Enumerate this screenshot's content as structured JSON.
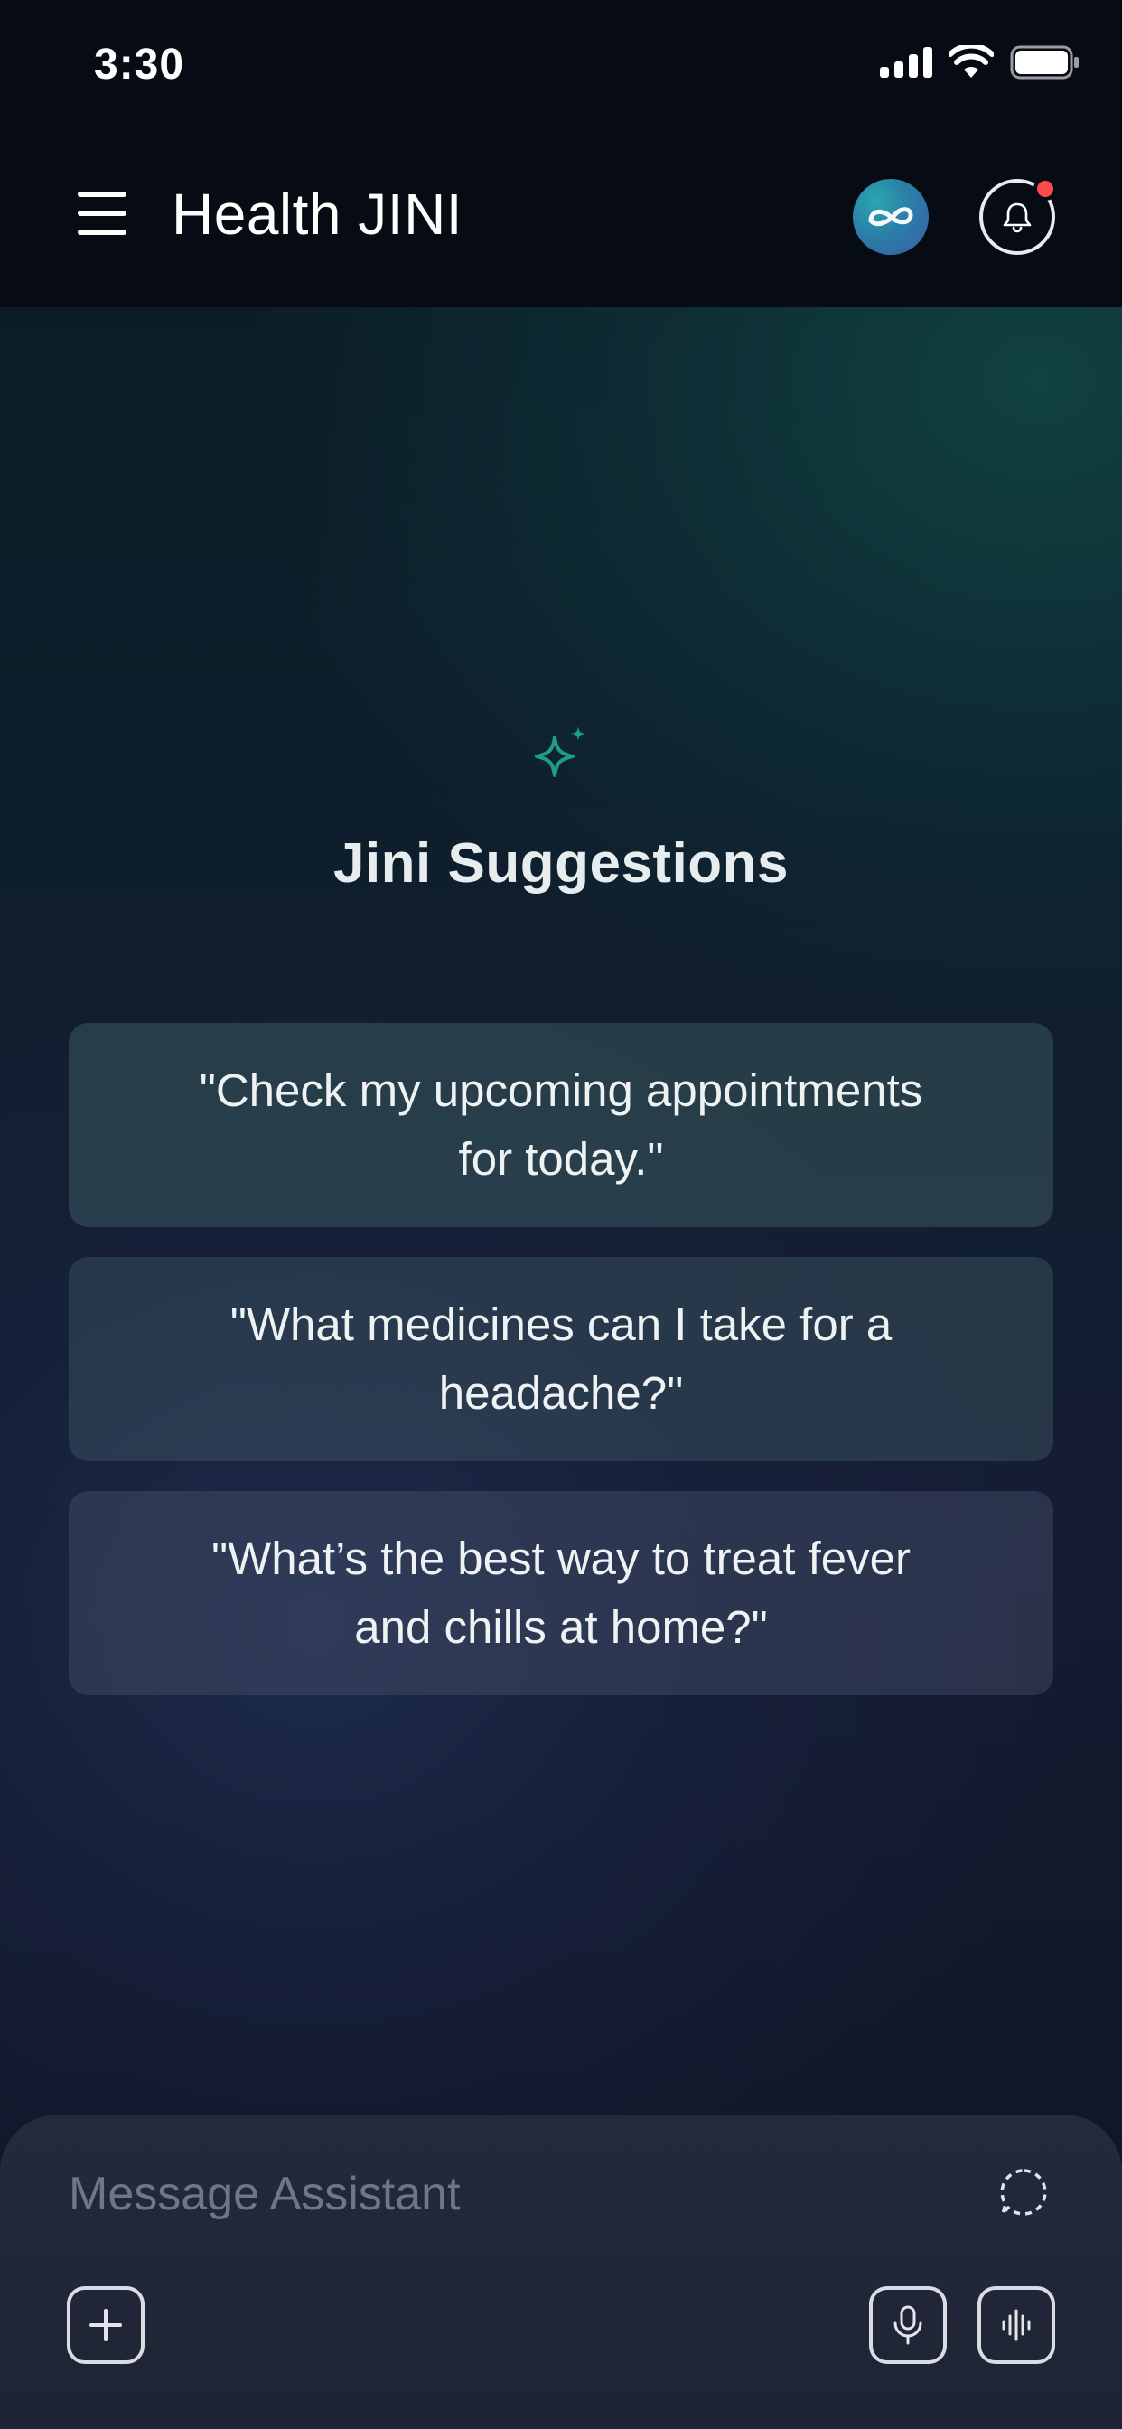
{
  "status_bar": {
    "time": "3:30"
  },
  "header": {
    "title": "Health JINI"
  },
  "suggestions": {
    "title": "Jini Suggestions",
    "items": [
      {
        "text": "\"Check my upcoming appointments for today.\""
      },
      {
        "text": "\"What medicines can I take for a headache?\""
      },
      {
        "text": "\"What’s the best way to treat fever and chills at home?\""
      }
    ]
  },
  "composer": {
    "placeholder": "Message Assistant"
  },
  "colors": {
    "accent": "#1f9a8c",
    "notification": "#ff4a4a",
    "background_top": "#070b14"
  }
}
